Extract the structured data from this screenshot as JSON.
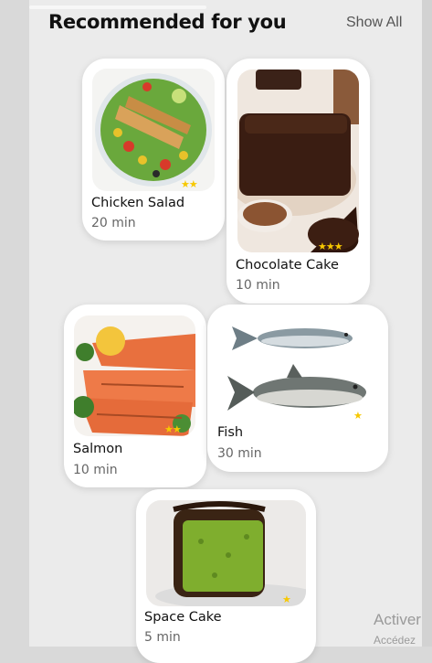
{
  "header": {
    "title": "Recommended for you",
    "show_all_label": "Show All"
  },
  "recipes": [
    {
      "name": "Chicken Salad",
      "time": "20 min",
      "stars": "★★"
    },
    {
      "name": "Chocolate Cake",
      "time": "10 min",
      "stars": "★★★"
    },
    {
      "name": "Salmon",
      "time": "10 min",
      "stars": "★★"
    },
    {
      "name": "Fish",
      "time": "30 min",
      "stars": "★"
    },
    {
      "name": "Space Cake",
      "time": "5 min",
      "stars": "★"
    }
  ],
  "watermark": {
    "line1": "Activer",
    "line2": "Accédez"
  },
  "colors": {
    "star": "#f7c800",
    "background": "#ebebeb",
    "card": "#ffffff"
  }
}
